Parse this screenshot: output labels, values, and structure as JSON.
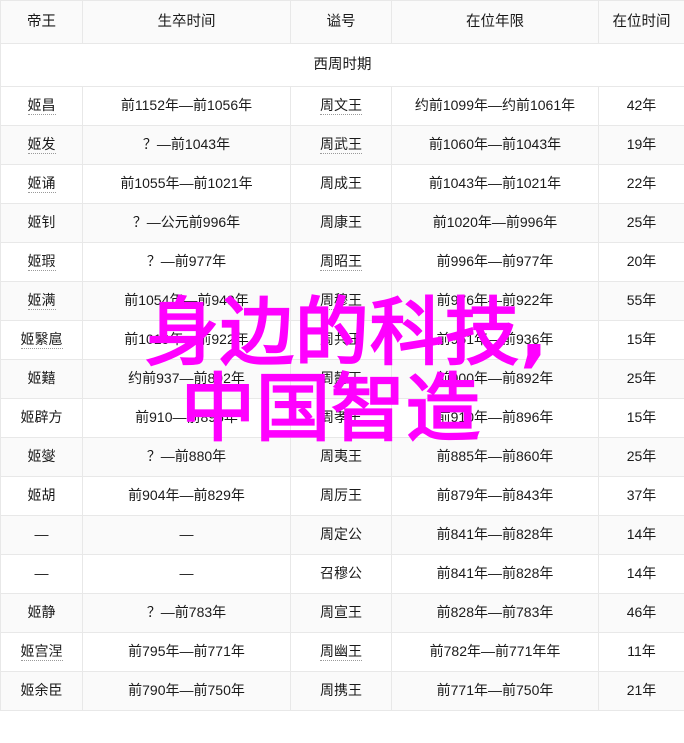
{
  "table": {
    "columns": [
      {
        "key": "name",
        "label": "帝王"
      },
      {
        "key": "life",
        "label": "生卒时间"
      },
      {
        "key": "posth",
        "label": "谥号"
      },
      {
        "key": "reignyr",
        "label": "在位年限"
      },
      {
        "key": "reigndu",
        "label": "在位时间"
      }
    ],
    "section_label": "西周时期",
    "rows": [
      {
        "name": "姬昌",
        "name_dotted": true,
        "life": "前1152年—前1056年",
        "life_dotted": false,
        "posth": "周文王",
        "posth_dotted": true,
        "reignyr": "约前1099年—约前1061年",
        "reigndu": "42年"
      },
      {
        "name": "姬发",
        "name_dotted": true,
        "life": "？—前1043年",
        "life_dotted": false,
        "posth": "周武王",
        "posth_dotted": true,
        "reignyr": "前1060年—前1043年",
        "reigndu": "19年"
      },
      {
        "name": "姬诵",
        "name_dotted": true,
        "life": "前1055年—前1021年",
        "life_dotted": false,
        "posth": "周成王",
        "posth_dotted": false,
        "reignyr": "前1043年—前1021年",
        "reigndu": "22年"
      },
      {
        "name": "姬钊",
        "name_dotted": false,
        "life": "？—公元前996年",
        "life_dotted": false,
        "posth": "周康王",
        "posth_dotted": false,
        "reignyr": "前1020年—前996年",
        "reigndu": "25年"
      },
      {
        "name": "姬瑕",
        "name_dotted": true,
        "life": "？—前977年",
        "life_dotted": false,
        "posth": "周昭王",
        "posth_dotted": true,
        "reignyr": "前996年—前977年",
        "reigndu": "20年"
      },
      {
        "name": "姬满",
        "name_dotted": true,
        "life": "前1054年—前949年",
        "life_dotted": false,
        "posth": "周穆王",
        "posth_dotted": true,
        "reignyr": "前976年—前922年",
        "reigndu": "55年"
      },
      {
        "name": "姬繄扈",
        "name_dotted": true,
        "life": "前1019年—前922年",
        "life_dotted": false,
        "posth": "周共王",
        "posth_dotted": false,
        "reignyr": "前951年—前936年",
        "reigndu": "15年"
      },
      {
        "name": "姬囏",
        "name_dotted": false,
        "life": "约前937—前892年",
        "life_dotted": false,
        "posth": "周懿王",
        "posth_dotted": false,
        "reignyr": "前900年—前892年",
        "reigndu": "25年"
      },
      {
        "name": "姬辟方",
        "name_dotted": false,
        "life": "前910—前896年",
        "life_dotted": false,
        "posth": "周孝王",
        "posth_dotted": false,
        "reignyr": "前910年—前896年",
        "reigndu": "15年"
      },
      {
        "name": "姬燮",
        "name_dotted": false,
        "life": "？—前880年",
        "life_dotted": false,
        "posth": "周夷王",
        "posth_dotted": false,
        "reignyr": "前885年—前860年",
        "reigndu": "25年"
      },
      {
        "name": "姬胡",
        "name_dotted": false,
        "life": "前904年—前829年",
        "life_dotted": false,
        "posth": "周厉王",
        "posth_dotted": false,
        "reignyr": "前879年—前843年",
        "reigndu": "37年"
      },
      {
        "name": "—",
        "name_dotted": false,
        "life": "—",
        "life_dotted": false,
        "posth": "周定公",
        "posth_dotted": false,
        "reignyr": "前841年—前828年",
        "reigndu": "14年"
      },
      {
        "name": "—",
        "name_dotted": false,
        "life": "—",
        "life_dotted": false,
        "posth": "召穆公",
        "posth_dotted": false,
        "reignyr": "前841年—前828年",
        "reigndu": "14年"
      },
      {
        "name": "姬静",
        "name_dotted": false,
        "life": "？—前783年",
        "life_dotted": false,
        "posth": "周宣王",
        "posth_dotted": false,
        "reignyr": "前828年—前783年",
        "reigndu": "46年"
      },
      {
        "name": "姬宫涅",
        "name_dotted": true,
        "life": "前795年—前771年",
        "life_dotted": false,
        "posth": "周幽王",
        "posth_dotted": true,
        "reignyr": "前782年—前771年年",
        "reigndu": "11年"
      },
      {
        "name": "姬余臣",
        "name_dotted": false,
        "life": "前790年—前750年",
        "life_dotted": false,
        "posth": "周携王",
        "posth_dotted": false,
        "reignyr": "前771年—前750年",
        "reigndu": "21年"
      }
    ]
  },
  "watermark": {
    "line1": "身边的科技,",
    "line2": "中国智造",
    "color": "#ff00ff"
  }
}
